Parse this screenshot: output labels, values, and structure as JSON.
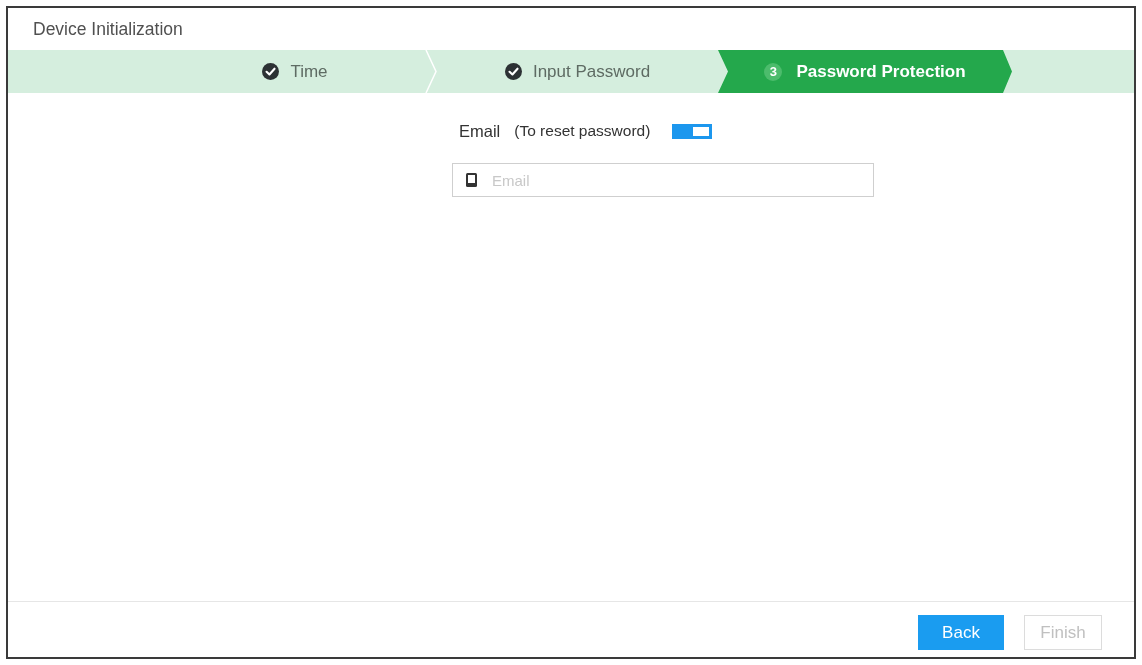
{
  "window": {
    "title": "Device Initialization"
  },
  "steps": [
    {
      "label": "Time",
      "completed": true,
      "selected": false
    },
    {
      "label": "Input Password",
      "completed": true,
      "selected": false
    },
    {
      "label": "Password Protection",
      "number": "3",
      "completed": false,
      "selected": true
    }
  ],
  "email": {
    "label": "Email",
    "hint": "(To reset password)",
    "toggle": {
      "on": true
    },
    "input": {
      "placeholder": "Email"
    }
  },
  "buttons": [
    {
      "label": "Back",
      "disabled": false
    },
    {
      "label": "Finish",
      "disabled": true
    }
  ]
}
